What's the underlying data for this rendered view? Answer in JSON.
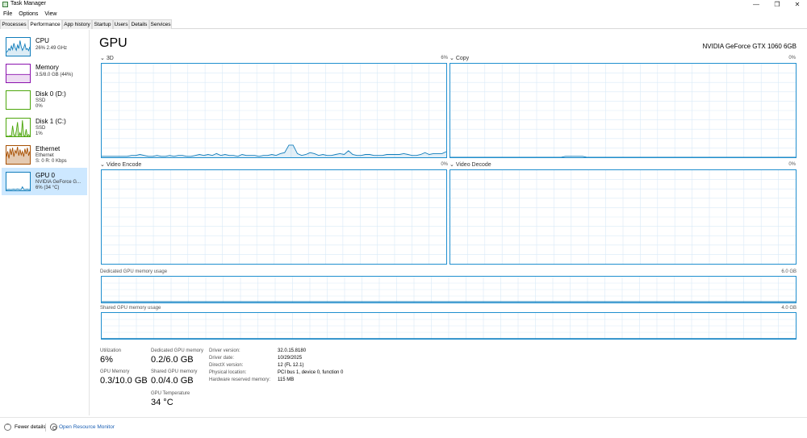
{
  "window": {
    "title": "Task Manager",
    "minimize": "—",
    "maximize": "❐",
    "close": "✕"
  },
  "menu": [
    "File",
    "Options",
    "View"
  ],
  "tabs": [
    "Processes",
    "Performance",
    "App history",
    "Startup",
    "Users",
    "Details",
    "Services"
  ],
  "sidebar": {
    "cpu": {
      "name": "CPU",
      "sub": "26% 2.49 GHz",
      "color": "#117dbb"
    },
    "memory": {
      "name": "Memory",
      "sub": "3.5/8.0 GB (44%)",
      "color": "#8b12ae"
    },
    "disk0": {
      "name": "Disk 0 (D:)",
      "sub1": "SSD",
      "sub2": "0%",
      "color": "#4da60c"
    },
    "disk1": {
      "name": "Disk 1 (C:)",
      "sub1": "SSD",
      "sub2": "1%",
      "color": "#4da60c"
    },
    "ethernet": {
      "name": "Ethernet",
      "sub1": "Ethernet",
      "sub2": "S: 0 R: 0 Kbps",
      "color": "#a74f01"
    },
    "gpu": {
      "name": "GPU 0",
      "sub1": "NVIDIA GeForce G...",
      "sub2": "6% (34 °C)",
      "color": "#117dbb"
    }
  },
  "main": {
    "title": "GPU",
    "adapter": "NVIDIA GeForce GTX 1060 6GB",
    "graphs": {
      "3d": {
        "label": "3D",
        "pct": "6%"
      },
      "copy": {
        "label": "Copy",
        "pct": "0%"
      },
      "encode": {
        "label": "Video Encode",
        "pct": "0%"
      },
      "decode": {
        "label": "Video Decode",
        "pct": "0%"
      }
    },
    "dedicated_mem": {
      "label": "Dedicated GPU memory usage",
      "max": "6.0 GB"
    },
    "shared_mem": {
      "label": "Shared GPU memory usage",
      "max": "4.0 GB"
    }
  },
  "stats": {
    "utilization": {
      "label": "Utilization",
      "value": "6%"
    },
    "dedicated": {
      "label": "Dedicated GPU memory",
      "value": "0.2/6.0 GB"
    },
    "gpu_memory": {
      "label": "GPU Memory",
      "value": "0.3/10.0 GB"
    },
    "shared": {
      "label": "Shared GPU memory",
      "value": "0.0/4.0 GB"
    },
    "temperature": {
      "label": "GPU Temperature",
      "value": "34 °C"
    }
  },
  "info": [
    {
      "key": "Driver version:",
      "value": "32.0.15.8180"
    },
    {
      "key": "Driver date:",
      "value": "10/29/2025"
    },
    {
      "key": "DirectX version:",
      "value": "12 (FL 12.1)"
    },
    {
      "key": "Physical location:",
      "value": "PCI bus 1, device 0, function 0"
    },
    {
      "key": "Hardware reserved memory:",
      "value": "115 MB"
    }
  ],
  "footer": {
    "fewer_details": "Fewer details",
    "resource_monitor": "Open Resource Monitor"
  },
  "colors": {
    "accent": "#117dbb",
    "grid": "#d9eaf7",
    "selected": "#cde8ff"
  },
  "series": {
    "3d": [
      1,
      1,
      1,
      1,
      1,
      1,
      1,
      2,
      2,
      3,
      2,
      1,
      1,
      2,
      1,
      1,
      2,
      1,
      2,
      2,
      1,
      1,
      2,
      3,
      2,
      3,
      2,
      4,
      2,
      3,
      2,
      2,
      1,
      3,
      2,
      2,
      2,
      1,
      2,
      2,
      3,
      2,
      4,
      5,
      13,
      13,
      4,
      2,
      3,
      5,
      4,
      2,
      3,
      2,
      2,
      3,
      4,
      3,
      7,
      3,
      2,
      2,
      3,
      3,
      2,
      2,
      2,
      3,
      3,
      3,
      3,
      4,
      3,
      2,
      2,
      3,
      5,
      3,
      4,
      4,
      4,
      6
    ],
    "copy": [
      0,
      0,
      0,
      0,
      0,
      0,
      0,
      0,
      0,
      0,
      0,
      0,
      0,
      0,
      0,
      0,
      0,
      0,
      0,
      0,
      0,
      0,
      0,
      0,
      0,
      0,
      0,
      1,
      1,
      1,
      1,
      1,
      0,
      0,
      0,
      0,
      0,
      0,
      0,
      0,
      0,
      0,
      0,
      0,
      0,
      0,
      0,
      0,
      0,
      0,
      0,
      0,
      0,
      0,
      0,
      0,
      0,
      0,
      0,
      0,
      0,
      0,
      0,
      0,
      0,
      0,
      0,
      0,
      0,
      0,
      0,
      0,
      0,
      0,
      0,
      0,
      0,
      0,
      0,
      0,
      0,
      0
    ],
    "sidebar_cpu": [
      20,
      25,
      40,
      30,
      55,
      35,
      70,
      45,
      30,
      60,
      40,
      85,
      50,
      30,
      45,
      65,
      35,
      40,
      28,
      50
    ],
    "sidebar_mem": [
      44,
      44,
      44,
      44,
      44,
      44,
      44,
      44,
      44,
      44,
      44,
      44,
      44,
      44,
      44,
      44,
      44,
      44,
      44,
      44
    ],
    "sidebar_disk1": [
      0,
      2,
      0,
      5,
      0,
      60,
      10,
      0,
      30,
      80,
      0,
      20,
      0,
      90,
      5,
      0,
      40,
      0,
      10,
      0
    ],
    "sidebar_eth": [
      40,
      70,
      30,
      85,
      50,
      90,
      40,
      75,
      60,
      95,
      45,
      80,
      50,
      70,
      40,
      85,
      55,
      90,
      45,
      70
    ],
    "sidebar_gpu": [
      5,
      5,
      6,
      5,
      5,
      6,
      7,
      5,
      6,
      8,
      6,
      5,
      6,
      20,
      6,
      5,
      6,
      7,
      5,
      6
    ]
  }
}
